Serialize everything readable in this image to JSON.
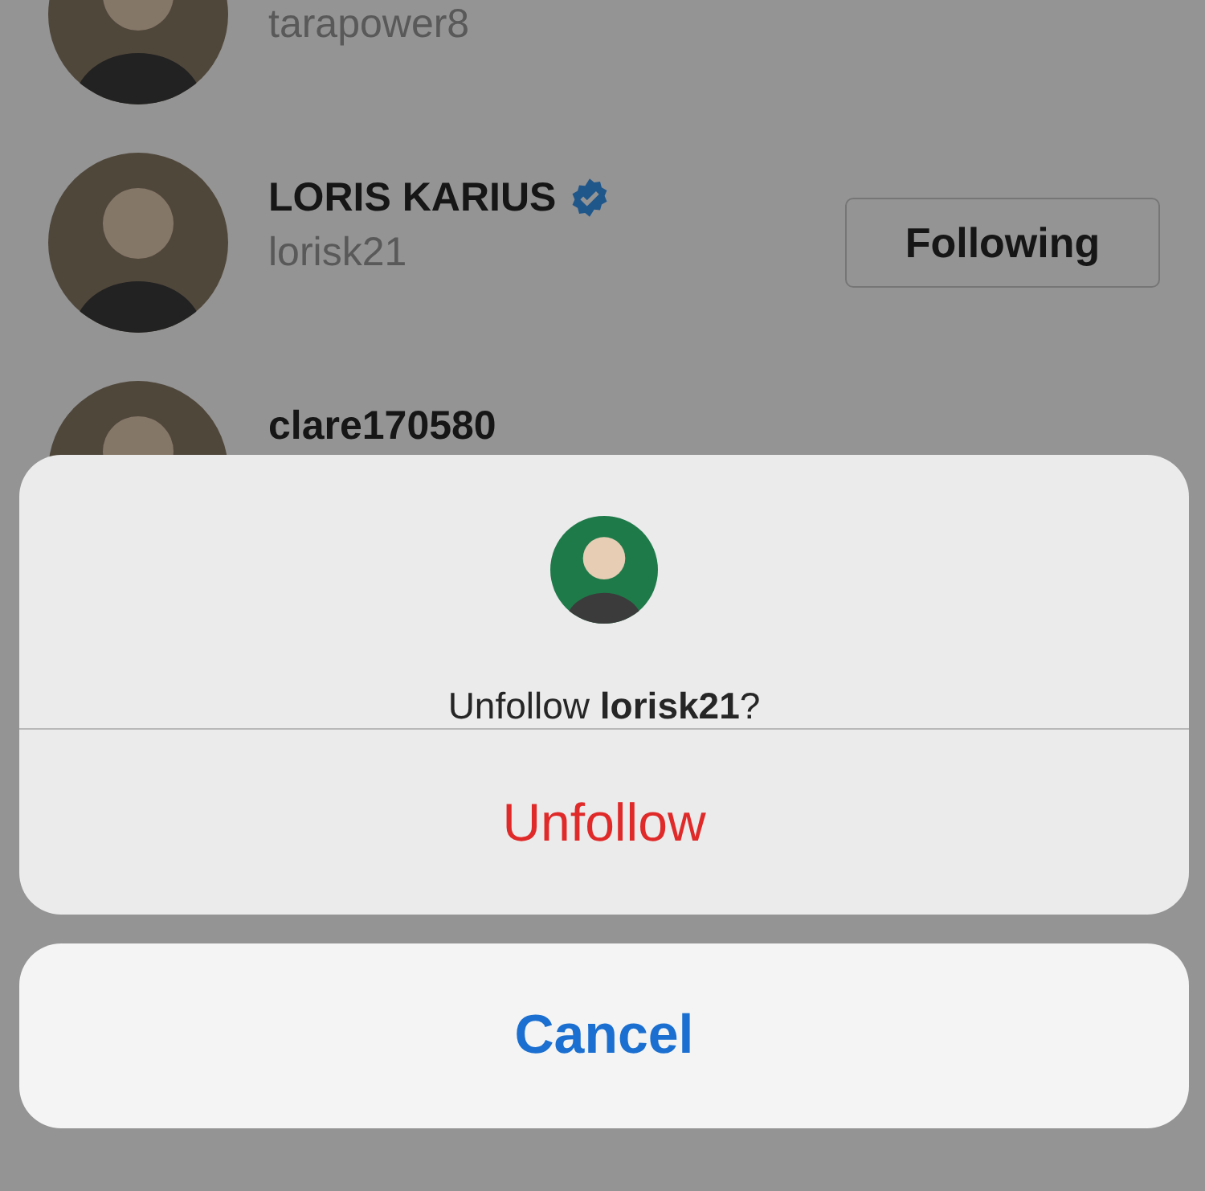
{
  "following_list": [
    {
      "handle": "tarapower8"
    },
    {
      "name": "LORIS KARIUS",
      "handle": "lorisk21",
      "verified": true,
      "button": "Following"
    },
    {
      "name": "clare170580"
    }
  ],
  "action_sheet": {
    "message": "Unfollow **lorisk21**?",
    "destructive_action": "Unfollow",
    "cancel": "Cancel"
  }
}
